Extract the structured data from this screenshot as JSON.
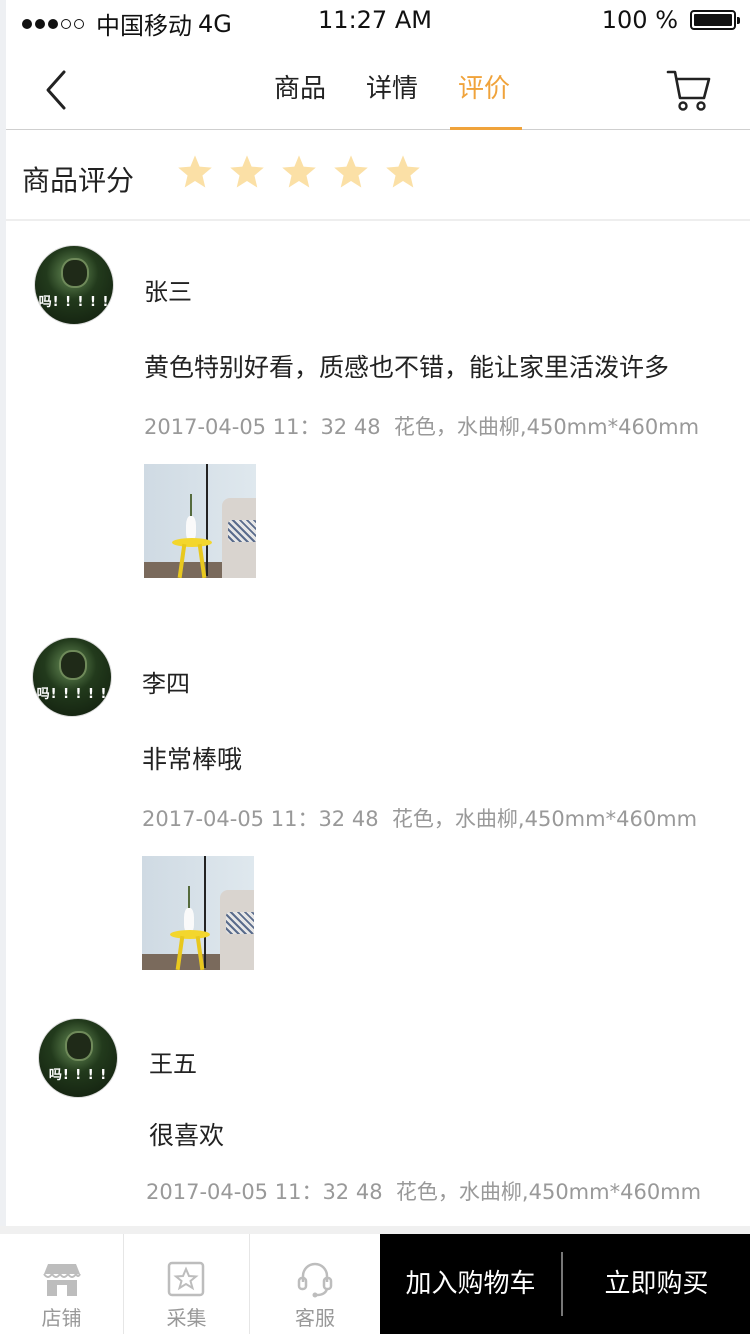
{
  "status_bar": {
    "carrier": "中国移动",
    "network": "4G",
    "time": "11:27 AM",
    "battery": "100 %"
  },
  "nav": {
    "tabs": [
      {
        "label": "商品",
        "active": false
      },
      {
        "label": "详情",
        "active": false
      },
      {
        "label": "评价",
        "active": true
      }
    ],
    "active_color": "#f0a33b"
  },
  "rating": {
    "label": "商品评分",
    "stars": 5,
    "star_color": "#fbe0a6"
  },
  "reviews": [
    {
      "user": "张三",
      "avatar_caption": "吗! ! ! ! !",
      "text": "黄色特别好看，质感也不错，能让家里活泼许多",
      "time": "2017-04-05 11：32 48",
      "spec": "花色，水曲柳,450mm*460mm",
      "has_photo": true
    },
    {
      "user": "李四",
      "avatar_caption": "吗! ! ! ! !",
      "text": "非常棒哦",
      "time": "2017-04-05 11：32 48",
      "spec": "花色，水曲柳,450mm*460mm",
      "has_photo": true
    },
    {
      "user": "王五",
      "avatar_caption": "吗! ! ! !",
      "text": "很喜欢",
      "time": "2017-04-05 11：32 48",
      "spec": "花色，水曲柳,450mm*460mm",
      "has_photo": false
    }
  ],
  "bottom_bar": {
    "shop_label": "店铺",
    "collect_label": "采集",
    "service_label": "客服",
    "add_to_cart_label": "加入购物车",
    "buy_now_label": "立即购买"
  }
}
